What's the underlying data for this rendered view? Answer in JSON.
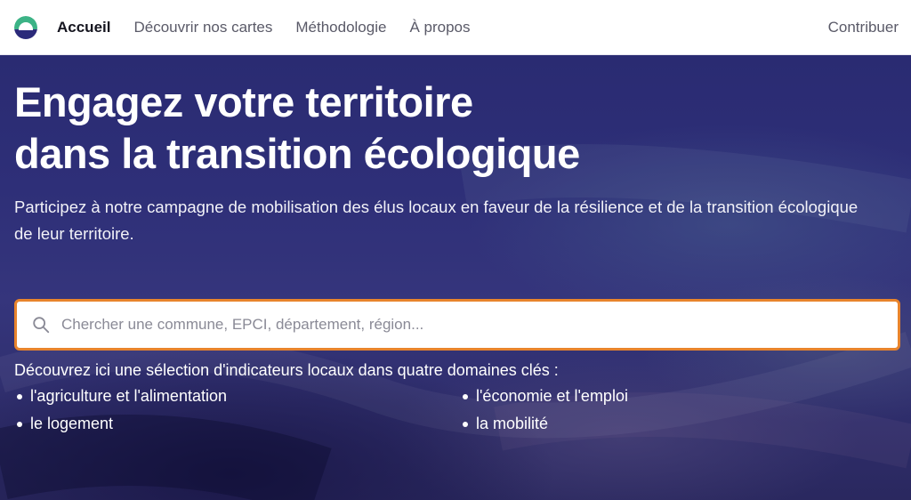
{
  "nav": {
    "links": [
      "Accueil",
      "Découvrir nos cartes",
      "Méthodologie",
      "À propos"
    ],
    "right_link": "Contribuer"
  },
  "hero": {
    "title_line1": "Engagez votre territoire",
    "title_line2": "dans la transition écologique",
    "subtitle": "Participez à notre campagne de mobilisation des élus locaux en faveur de la résilience et de la transition écologique de leur territoire."
  },
  "search": {
    "placeholder": "Chercher une commune, EPCI, département, région...",
    "value": ""
  },
  "intro": "Découvrez ici une sélection d'indicateurs locaux dans quatre domaines clés :",
  "domains": [
    "l'agriculture et l'alimentation",
    "l'économie et l'emploi",
    "le logement",
    "la mobilité"
  ],
  "colors": {
    "accent_orange": "#e8842c",
    "hero_overlay": "#2e2f78",
    "logo_green": "#3cb386",
    "logo_navy": "#2b2a7a"
  },
  "icons": {
    "logo": "app-logo",
    "search": "search-icon"
  }
}
